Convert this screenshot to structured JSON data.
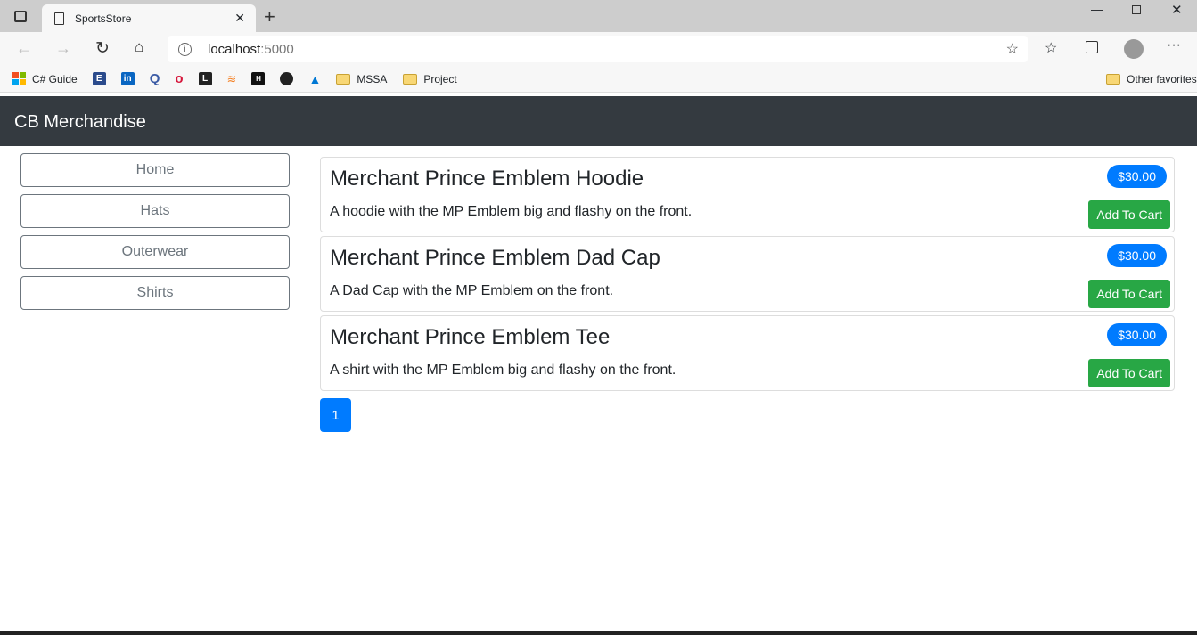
{
  "browser": {
    "tab_title": "SportsStore",
    "url_host": "localhost",
    "url_port": ":5000",
    "bookmarks": [
      {
        "label": "C# Guide"
      },
      {
        "label": "MSSA"
      },
      {
        "label": "Project"
      }
    ],
    "other_favorites": "Other favorites"
  },
  "navbar": {
    "brand": "CB Merchandise"
  },
  "sidebar": {
    "items": [
      {
        "label": "Home"
      },
      {
        "label": "Hats"
      },
      {
        "label": "Outerwear"
      },
      {
        "label": "Shirts"
      }
    ]
  },
  "products": [
    {
      "name": "Merchant Prince Emblem Hoodie",
      "price": "$30.00",
      "description": "A hoodie with the MP Emblem big and flashy on the front.",
      "button": "Add To Cart"
    },
    {
      "name": "Merchant Prince Emblem Dad Cap",
      "price": "$30.00",
      "description": "A Dad Cap with the MP Emblem on the front.",
      "button": "Add To Cart"
    },
    {
      "name": "Merchant Prince Emblem Tee",
      "price": "$30.00",
      "description": "A shirt with the MP Emblem big and flashy on the front.",
      "button": "Add To Cart"
    }
  ],
  "pagination": {
    "current": "1"
  }
}
